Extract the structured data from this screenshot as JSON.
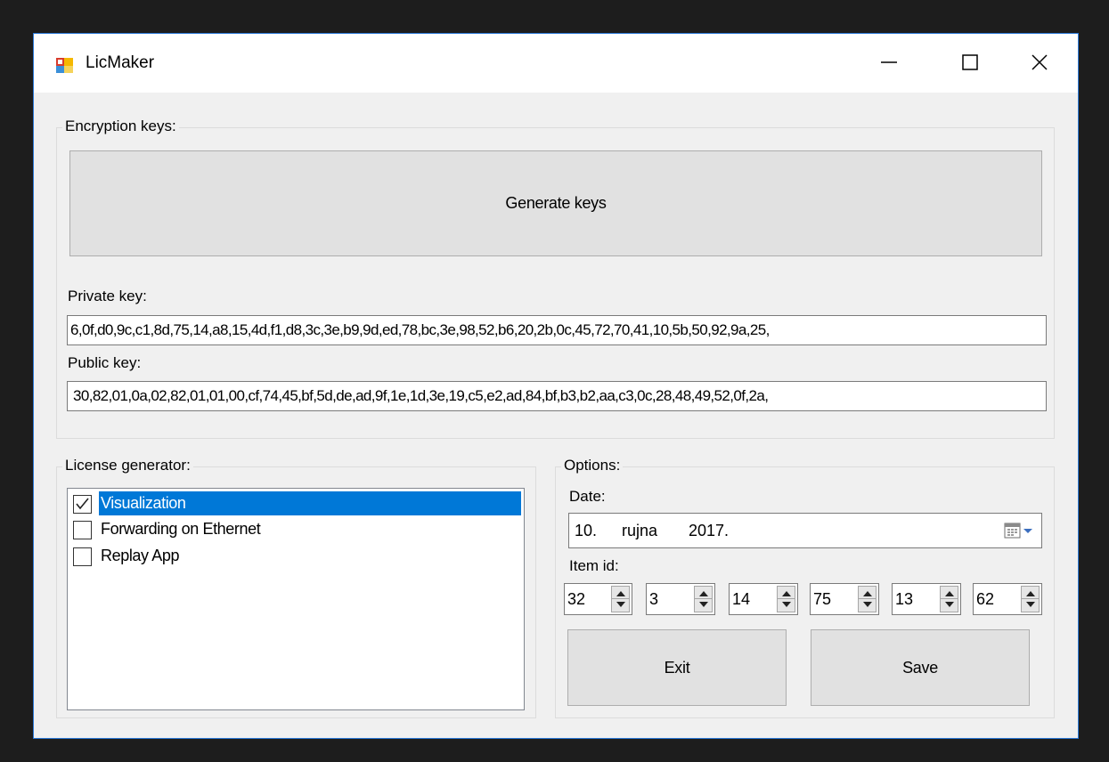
{
  "window": {
    "title": "LicMaker",
    "controls": {
      "minimize": "minimize",
      "maximize": "maximize",
      "close": "close"
    }
  },
  "encryption": {
    "group_label": "Encryption keys:",
    "generate_button": "Generate keys",
    "private_label": "Private key:",
    "private_value": "6,0f,d0,9c,c1,8d,75,14,a8,15,4d,f1,d8,3c,3e,b9,9d,ed,78,bc,3e,98,52,b6,20,2b,0c,45,72,70,41,10,5b,50,92,9a,25,",
    "public_label": "Public key:",
    "public_value": "30,82,01,0a,02,82,01,01,00,cf,74,45,bf,5d,de,ad,9f,1e,1d,3e,19,c5,e2,ad,84,bf,b3,b2,aa,c3,0c,28,48,49,52,0f,2a,"
  },
  "license": {
    "group_label": "License generator:",
    "items": [
      {
        "label": "Visualization",
        "checked": true,
        "selected": true
      },
      {
        "label": "Forwarding on Ethernet",
        "checked": false,
        "selected": false
      },
      {
        "label": "Replay App",
        "checked": false,
        "selected": false
      }
    ]
  },
  "options": {
    "group_label": "Options:",
    "date_label": "Date:",
    "date": {
      "day": "10.",
      "month": "rujna",
      "year": "2017."
    },
    "item_id_label": "Item id:",
    "item_ids": [
      "32",
      "3",
      "14",
      "75",
      "13",
      "62"
    ],
    "exit_button": "Exit",
    "save_button": "Save"
  },
  "colors": {
    "accent": "#0078d7",
    "window_border": "#2b79d8"
  }
}
